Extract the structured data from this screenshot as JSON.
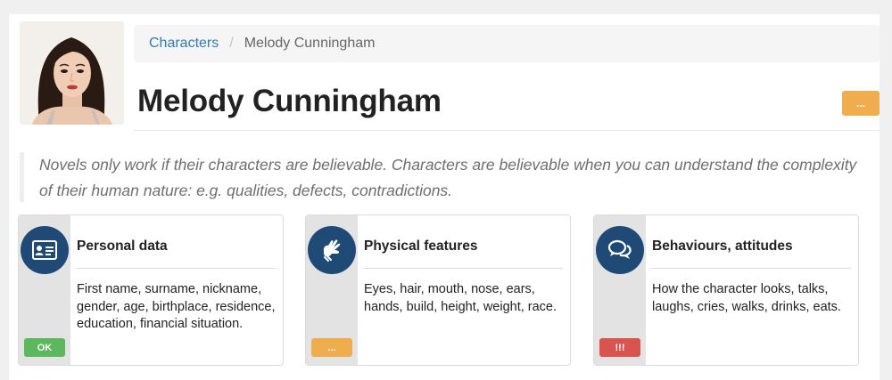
{
  "breadcrumb": {
    "root": "Characters",
    "separator": "/",
    "current": "Melody Cunningham"
  },
  "page": {
    "title": "Melody Cunningham",
    "menu_label": "...",
    "intro": "Novels only work if their characters are believable. Characters are believable when you can understand the complexity of their human nature: e.g. qualities, defects, contradictions."
  },
  "cards": [
    {
      "title": "Personal data",
      "description": "First name, surname, nickname, gender, age, birthplace, residence, education, financial situation.",
      "icon": "id-card-icon",
      "status": "OK",
      "status_color": "#5cb85c"
    },
    {
      "title": "Physical features",
      "description": "Eyes, hair, mouth, nose, ears, hands, build, height, weight, race.",
      "icon": "sign-language-icon",
      "status": "...",
      "status_color": "#f0ad4e"
    },
    {
      "title": "Behaviours, attitudes",
      "description": "How the character looks, talks, laughs, cries, walks, drinks, eats.",
      "icon": "chat-bubbles-icon",
      "status": "!!!",
      "status_color": "#d9534f"
    }
  ],
  "colors": {
    "link": "#337ab7",
    "icon_circle": "#1f4a75",
    "menu_button": "#f0ad4e"
  }
}
